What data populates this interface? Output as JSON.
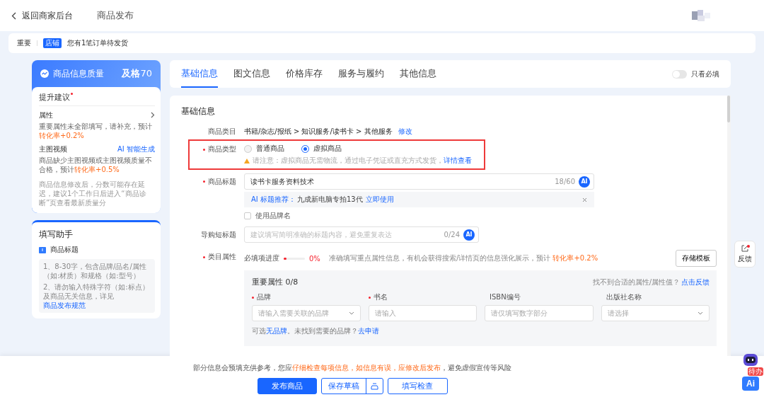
{
  "header": {
    "back_label": "返回商家后台",
    "title": "商品发布"
  },
  "notice": {
    "level": "重要",
    "tag": "店铺",
    "text": "您有1笔订单待发货"
  },
  "quality": {
    "title": "商品信息质量",
    "grade": "及格",
    "score": "70",
    "suggestions_title": "提升建议",
    "items": [
      {
        "name": "属性",
        "kind": "detail",
        "desc": [
          {
            "kind": "plain",
            "text": "重要属性未全部填写，请补充，预计"
          },
          {
            "kind": "emphasis",
            "text": "转化率+0.2%"
          }
        ]
      },
      {
        "name": "主图视频",
        "kind": "generate",
        "action": "AI 智能生成",
        "desc": [
          {
            "kind": "plain",
            "text": "商品缺少主图视频或主图视频质量不合格，预计"
          },
          {
            "kind": "emphasis",
            "text": "转化率+0.5%"
          }
        ]
      }
    ],
    "note": "商品信息修改后，分数可能存在延迟，建议1个工作日后进入“商品诊断”页查看最新质量分"
  },
  "helper": {
    "title": "填写助手",
    "section": "商品标题",
    "lines": [
      [
        {
          "kind": "plain",
          "text": "1、8-30字，包含品牌/品名/属性（如:材质）和规格（如:型号）"
        }
      ],
      [
        {
          "kind": "plain",
          "text": "2、请勿输入特殊字符（如:标点）及商品无关信息，详见 "
        },
        {
          "kind": "link",
          "text": "商品发布规范"
        }
      ]
    ]
  },
  "tabs": [
    {
      "label": "基础信息",
      "selected": true
    },
    {
      "label": "图文信息",
      "selected": false
    },
    {
      "label": "价格库存",
      "selected": false
    },
    {
      "label": "服务与履约",
      "selected": false
    },
    {
      "label": "其他信息",
      "selected": false
    }
  ],
  "required_only": {
    "label": "只看必填",
    "on": false
  },
  "form": {
    "section_title": "基础信息",
    "category": {
      "label": "商品类目",
      "path": "书籍/杂志/报纸 > 知识服务/读书卡 > 其他服务",
      "link": "修改"
    },
    "type": {
      "label": "商品类型",
      "required": true,
      "highlighted": true,
      "options": [
        {
          "label": "普通商品",
          "selected": false
        },
        {
          "label": "虚拟商品",
          "selected": true
        }
      ],
      "warning": [
        {
          "kind": "plain",
          "text": "请注意：虚拟商品无需物流，通过电子凭证或直充方式发货，"
        },
        {
          "kind": "link",
          "text": "详情查看"
        }
      ]
    },
    "title": {
      "label": "商品标题",
      "required": true,
      "value": "读书卡服务资料技术",
      "counter": "18/60",
      "ai": "AI",
      "suggestion_label": "AI 标题推荐：",
      "suggestion": "九成新电脑专拍13代",
      "suggestion_link": "立即使用"
    },
    "brand_name": {
      "label": "使用品牌名",
      "checked": false
    },
    "short_title": {
      "label": "导购短标题",
      "required": false,
      "placeholder": "建议填写简明准确的标题内容，避免重复表达",
      "counter": "0/24",
      "ai": "AI"
    },
    "attributes": {
      "label": "类目属性",
      "required": true,
      "progress_label": "必填项进度",
      "level": 0,
      "percent": "0%",
      "hint": [
        {
          "kind": "plain",
          "text": "准确填写重点属性信息，有机会获得搜索/详情页的信息强化展示，预计 "
        },
        {
          "kind": "emphasis",
          "text": "转化率+0.2%"
        }
      ],
      "template_button": "存储模板",
      "panel_title": "重要属性 0/8",
      "help": "找不到合适的属性/属性值？",
      "help_link": "点击反馈",
      "fields": [
        {
          "label": "品牌",
          "required": true,
          "kind": "select",
          "placeholder": "请输入需要关联的品牌"
        },
        {
          "label": "书名",
          "required": true,
          "kind": "input",
          "placeholder": "请输入"
        },
        {
          "label": "ISBN编号",
          "required": false,
          "kind": "input",
          "placeholder": "请仅填写数字部分"
        },
        {
          "label": "出版社名称",
          "required": false,
          "kind": "select",
          "placeholder": "请选择"
        }
      ],
      "brand_note": [
        {
          "kind": "plain",
          "text": "可选"
        },
        {
          "kind": "link",
          "text": "无品牌"
        },
        {
          "kind": "plain",
          "text": "。未找到需要的品牌？"
        },
        {
          "kind": "link",
          "text": "去申请"
        }
      ]
    }
  },
  "footer": {
    "notice": [
      {
        "kind": "plain",
        "text": "部分信息会预填充供参考，您应"
      },
      {
        "kind": "emphasis",
        "text": "仔细检查每项信息，如信息有误，应修改后发布"
      },
      {
        "kind": "plain",
        "text": "，避免虚假宣传等风险"
      }
    ],
    "buttons": [
      {
        "label": "发布商品",
        "kind": "primary"
      },
      {
        "label": "保存草稿",
        "kind": "split"
      },
      {
        "label": "填写检查",
        "kind": "outline"
      }
    ]
  },
  "feedback": {
    "label": "反馈",
    "unread": true
  },
  "assistant": {
    "badge": "待办",
    "label": "Ai"
  }
}
